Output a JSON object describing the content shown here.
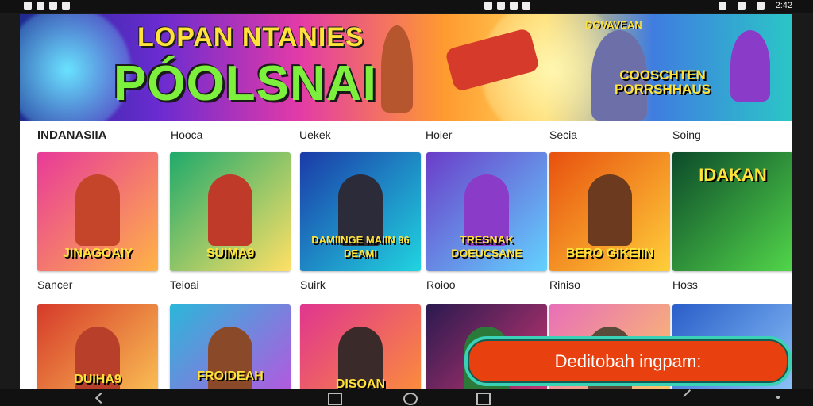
{
  "status_bar": {
    "left_icons": "notification icons",
    "time": "2:42"
  },
  "banner": {
    "title": "LOPAN NTANIES",
    "subtitle": "PÓOLSNAI",
    "badge_small": "DOVAVEAN",
    "promo": "COOSCHTEN PORRSHHAUS"
  },
  "section": {
    "title": "INDANASIIA",
    "tabs": [
      "Hooca",
      "Uekek",
      "Hoier",
      "Secia",
      "Soing"
    ]
  },
  "cards_row1": [
    {
      "label": "JINAGOAIY",
      "caption": "Sancer",
      "color_a": "#e83a9a",
      "color_b": "#ffb347"
    },
    {
      "label": "SUIMA9",
      "caption": "Teioai",
      "color_a": "#1faa6b",
      "color_b": "#ffe066"
    },
    {
      "label": "DAMIINGE MAIIN 96 DEAMI",
      "caption": "Suirk",
      "color_a": "#1b3aa8",
      "color_b": "#21d4e0"
    },
    {
      "label": "TRESNAK DOEUCSANE",
      "caption": "Roioo",
      "color_a": "#6b3dc9",
      "color_b": "#63d2ff"
    },
    {
      "label": "BERO GIKEIIN",
      "caption": "Riniso",
      "color_a": "#e8510f",
      "color_b": "#ffcf3a"
    },
    {
      "label": "IDAKAN",
      "caption": "Hoss",
      "color_a": "#0c4a2a",
      "color_b": "#52d64a"
    }
  ],
  "cards_row2": [
    {
      "label": "DUIHA9",
      "color_a": "#d63a2a",
      "color_b": "#ffd35a"
    },
    {
      "label": "FROIDEAH",
      "color_a": "#2bb7d9",
      "color_b": "#c94ae0"
    },
    {
      "label": "DISOAN",
      "color_a": "#e0358f",
      "color_b": "#ff9a2f"
    },
    {
      "label": "",
      "color_a": "#2a1a4f",
      "color_b": "#e03a78"
    },
    {
      "label": "",
      "color_a": "#e86fb8",
      "color_b": "#ffd35a"
    },
    {
      "label": "",
      "color_a": "#2a5ec9",
      "color_b": "#9ad2ff"
    }
  ],
  "cta": {
    "label": "Deditobah ingpam:"
  }
}
